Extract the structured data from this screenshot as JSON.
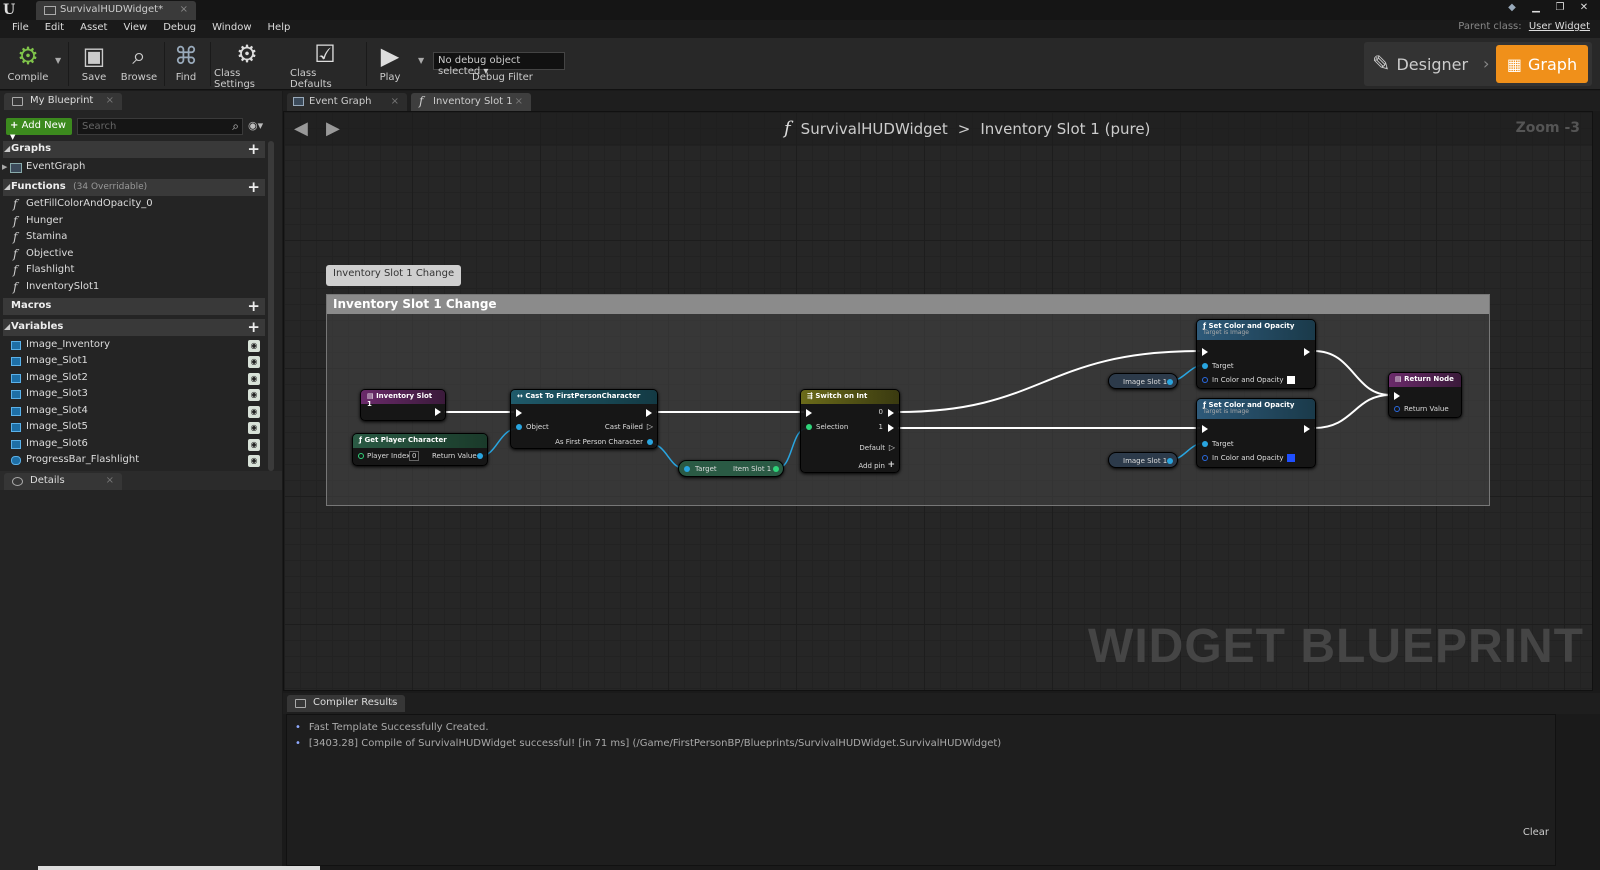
{
  "window": {
    "tab_title": "SurvivalHUDWidget*",
    "parent_class_label": "Parent class:",
    "parent_class_value": "User Widget"
  },
  "menu": [
    "File",
    "Edit",
    "Asset",
    "View",
    "Debug",
    "Window",
    "Help"
  ],
  "toolbar": {
    "compile": "Compile",
    "save": "Save",
    "browse": "Browse",
    "find": "Find",
    "class_settings": "Class Settings",
    "class_defaults": "Class Defaults",
    "play": "Play",
    "debug_select": "No debug object selected",
    "debug_filter": "Debug Filter",
    "designer": "Designer",
    "graph": "Graph"
  },
  "my_blueprint": {
    "tab": "My Blueprint",
    "add_new": "Add New",
    "search_placeholder": "Search",
    "graphs_header": "Graphs",
    "event_graph": "EventGraph",
    "functions_header": "Functions",
    "functions_sub": "(34 Overridable)",
    "functions": [
      "GetFillColorAndOpacity_0",
      "Hunger",
      "Stamina",
      "Objective",
      "Flashlight",
      "InventorySlot1"
    ],
    "macros_header": "Macros",
    "variables_header": "Variables",
    "variables": [
      "Image_Inventory",
      "Image_Slot1",
      "Image_Slot2",
      "Image_Slot3",
      "Image_Slot4",
      "Image_Slot5",
      "Image_Slot6",
      "ProgressBar_Flashlight"
    ]
  },
  "details_tab": "Details",
  "graph_tabs": [
    "Event Graph",
    "Inventory Slot 1"
  ],
  "graph": {
    "crumb_root": "SurvivalHUDWidget",
    "crumb_sep": ">",
    "crumb_leaf": "Inventory Slot 1 (pure)",
    "zoom": "Zoom -3",
    "watermark": "WIDGET BLUEPRINT",
    "comment_bubble": "Inventory Slot 1 Change",
    "comment_title": "Inventory Slot 1 Change",
    "nodes": {
      "entry": {
        "title": "Inventory Slot 1"
      },
      "get_player": {
        "title": "Get Player Character",
        "player_index": "Player Index",
        "player_index_value": "0",
        "return_value": "Return Value"
      },
      "cast": {
        "title": "Cast To FirstPersonCharacter",
        "object": "Object",
        "cast_failed": "Cast Failed",
        "as_fpc": "As First Person Character"
      },
      "item_getter": {
        "target": "Target",
        "item": "Item Slot 1"
      },
      "switch": {
        "title": "Switch on Int",
        "selection": "Selection",
        "pin0": "0",
        "pin1": "1",
        "default": "Default",
        "add_pin": "Add pin"
      },
      "set1": {
        "title": "Set Color and Opacity",
        "sub": "Target is Image",
        "target": "Target",
        "color": "In Color and Opacity",
        "swatch": "#ffffff"
      },
      "set2": {
        "title": "Set Color and Opacity",
        "sub": "Target is Image",
        "target": "Target",
        "color": "In Color and Opacity",
        "swatch": "#1f4fff"
      },
      "img1": {
        "label": "Image Slot 1"
      },
      "img2": {
        "label": "Image Slot 1"
      },
      "return": {
        "title": "Return Node",
        "return_value": "Return Value"
      }
    }
  },
  "compiler": {
    "tab": "Compiler Results",
    "messages": [
      "Fast Template Successfully Created.",
      "[3403.28] Compile of SurvivalHUDWidget successful! [in 71 ms] (/Game/FirstPersonBP/Blueprints/SurvivalHUDWidget.SurvivalHUDWidget)"
    ],
    "clear": "Clear"
  },
  "colors": {
    "accent": "#f0901a",
    "add_new": "#3c8a1e",
    "pin_blue": "#29a5e0",
    "cast_header": "#1f5a6a",
    "switch_header": "#6b6b1a",
    "func_header": "#6a2a6a",
    "set_header": "#2e5a7a",
    "getter_green": "#2a5a44"
  }
}
